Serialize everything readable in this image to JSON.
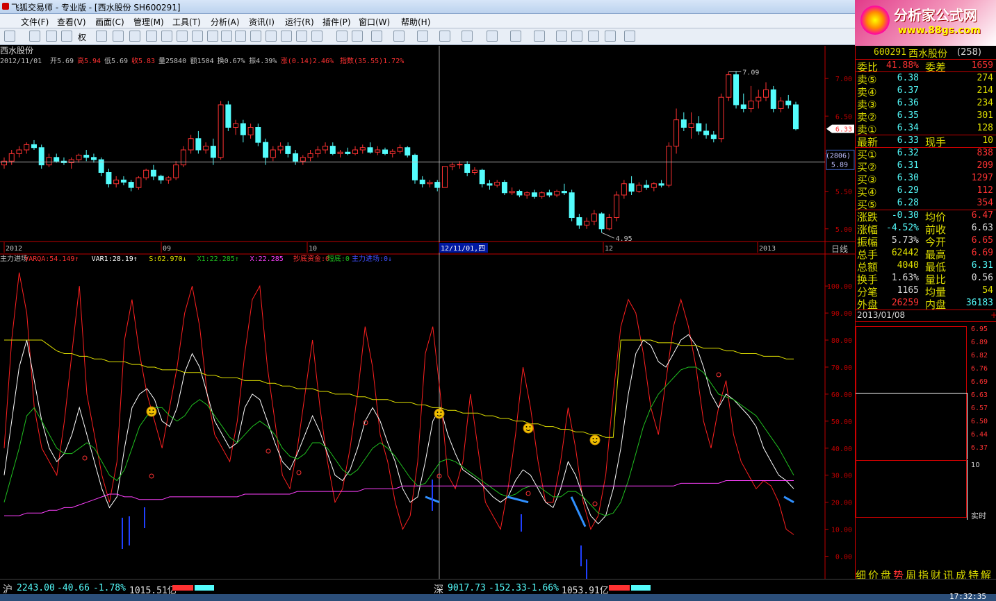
{
  "window": {
    "title": "飞狐交易师 - 专业版 - [西水股份 SH600291]"
  },
  "logo": {
    "line1": "分析家公式网",
    "line2": "www.88gs.com"
  },
  "menu": [
    "文件(F)",
    "查看(V)",
    "画面(C)",
    "管理(M)",
    "工具(T)",
    "分析(A)",
    "资讯(I)",
    "运行(R)",
    "插件(P)",
    "窗口(W)",
    "帮助(H)"
  ],
  "toolbar": {
    "quan": "权"
  },
  "info": {
    "stock": "西水股份",
    "date": "2012/11/01",
    "open": "开5.69",
    "high": "高5.94",
    "low": "低5.69",
    "close": "收5.83",
    "volume": "量25840",
    "amount": "额1504",
    "turnover": "换0.67%",
    "amplitude": "振4.39%",
    "change": "涨(0.14)2.46%",
    "index": "指数(35.55)1.72%"
  },
  "price_axis": [
    "7.00",
    "6.50",
    "6.00",
    "5.50",
    "5.00"
  ],
  "price_labels": {
    "current": "6.33",
    "cross_count": "(2806)",
    "cross_price": "5.89",
    "max": "7.09",
    "min": "4.95"
  },
  "date_axis": [
    "2012",
    "09",
    "10",
    "12/11/01,四",
    "12",
    "2013"
  ],
  "period": "日线",
  "indicator": {
    "name": "主力进场",
    "varqa": "VARQA:54.149",
    "var1": "VAR1:28.19",
    "s": "S:62.970",
    "x1": "X1:22.285",
    "x": "X:22.285",
    "chaodi": "抄底资金:0",
    "duandi": "短底:0",
    "zhuli": "主力进场:0"
  },
  "ind_axis": [
    "100.00",
    "90.00",
    "80.00",
    "70.00",
    "60.00",
    "50.00",
    "40.00",
    "30.00",
    "20.00",
    "10.00",
    "0.00"
  ],
  "quote": {
    "code": "600291",
    "name": "西水股份",
    "num": "(258)",
    "weibi_label": "委比",
    "weibi": "41.88%",
    "weicha_label": "委差",
    "weicha": "1659",
    "sell": [
      [
        "卖⑤",
        "6.38",
        "274"
      ],
      [
        "卖④",
        "6.37",
        "214"
      ],
      [
        "卖③",
        "6.36",
        "234"
      ],
      [
        "卖②",
        "6.35",
        "301"
      ],
      [
        "卖①",
        "6.34",
        "128"
      ]
    ],
    "last": [
      "最新",
      "6.33",
      "现手",
      "10"
    ],
    "buy": [
      [
        "买①",
        "6.32",
        "838"
      ],
      [
        "买②",
        "6.31",
        "209"
      ],
      [
        "买③",
        "6.30",
        "1297"
      ],
      [
        "买④",
        "6.29",
        "112"
      ],
      [
        "买⑤",
        "6.28",
        "354"
      ]
    ],
    "stats": [
      [
        "涨跌",
        "-0.30",
        "均价",
        "6.47"
      ],
      [
        "涨幅",
        "-4.52%",
        "前收",
        "6.63"
      ],
      [
        "振幅",
        "5.73%",
        "今开",
        "6.65"
      ],
      [
        "总手",
        "62442",
        "最高",
        "6.69"
      ],
      [
        "总额",
        "4040",
        "最低",
        "6.31"
      ],
      [
        "换手",
        "1.63%",
        "量比",
        "0.56"
      ],
      [
        "分笔",
        "1165",
        "均量",
        "54"
      ],
      [
        "外盘",
        "26259",
        "内盘",
        "36183"
      ]
    ],
    "mini_date": "2013/01/08",
    "mini_axis": [
      "6.95",
      "6.89",
      "6.82",
      "6.76",
      "6.69",
      "6.63",
      "6.57",
      "6.50",
      "6.44",
      "6.37"
    ],
    "mini_vol": "10",
    "mini_mode": "实时",
    "tabs": [
      "细",
      "价",
      "盘",
      "势",
      "周",
      "指",
      "财",
      "讯",
      "成",
      "特",
      "解"
    ]
  },
  "status": {
    "sh_label": "沪",
    "sh_index": "2243.00",
    "sh_change": "-40.66",
    "sh_pct": "-1.78%",
    "sh_amount": "1015.51亿",
    "sz_label": "深",
    "sz_index": "9017.73",
    "sz_change": "-152.33",
    "sz_pct": "-1.66%",
    "sz_amount": "1053.91亿",
    "time": "17:32:35"
  },
  "colors": {
    "up": "#ff3232",
    "down": "#54fcfc",
    "axis": "#c00000",
    "label": "#d8d800"
  },
  "chart_data": {
    "type": "candlestick",
    "title": "西水股份 日线",
    "candles": [
      [
        5.85,
        5.95,
        5.8,
        5.9
      ],
      [
        5.9,
        6.05,
        5.85,
        6.0
      ],
      [
        6.0,
        6.1,
        5.95,
        6.05
      ],
      [
        6.05,
        6.15,
        6.0,
        6.12
      ],
      [
        6.12,
        6.18,
        6.05,
        6.08
      ],
      [
        6.08,
        6.12,
        5.8,
        5.85
      ],
      [
        5.85,
        6.0,
        5.82,
        5.95
      ],
      [
        5.95,
        6.0,
        5.88,
        5.9
      ],
      [
        5.9,
        5.95,
        5.85,
        5.88
      ],
      [
        5.88,
        5.95,
        5.8,
        5.92
      ],
      [
        5.92,
        6.0,
        5.88,
        5.98
      ],
      [
        5.98,
        6.05,
        5.9,
        5.95
      ],
      [
        5.95,
        6.0,
        5.88,
        5.92
      ],
      [
        5.92,
        5.95,
        5.7,
        5.75
      ],
      [
        5.75,
        5.8,
        5.55,
        5.6
      ],
      [
        5.6,
        5.7,
        5.55,
        5.65
      ],
      [
        5.65,
        5.7,
        5.58,
        5.62
      ],
      [
        5.62,
        5.65,
        5.5,
        5.55
      ],
      [
        5.55,
        5.7,
        5.52,
        5.68
      ],
      [
        5.68,
        5.8,
        5.65,
        5.78
      ],
      [
        5.78,
        5.85,
        5.65,
        5.7
      ],
      [
        5.7,
        5.72,
        5.6,
        5.65
      ],
      [
        5.65,
        5.7,
        5.6,
        5.68
      ],
      [
        5.68,
        5.9,
        5.65,
        5.85
      ],
      [
        5.85,
        6.1,
        5.82,
        6.05
      ],
      [
        6.05,
        6.25,
        6.0,
        6.2
      ],
      [
        6.2,
        6.3,
        6.0,
        6.05
      ],
      [
        6.05,
        6.15,
        6.0,
        6.1
      ],
      [
        6.1,
        6.2,
        5.85,
        5.95
      ],
      [
        5.95,
        6.7,
        5.92,
        6.65
      ],
      [
        6.65,
        6.7,
        6.3,
        6.35
      ],
      [
        6.35,
        6.45,
        6.25,
        6.4
      ],
      [
        6.4,
        6.45,
        6.15,
        6.25
      ],
      [
        6.25,
        6.4,
        6.2,
        6.35
      ],
      [
        6.35,
        6.4,
        6.1,
        6.15
      ],
      [
        6.15,
        6.2,
        5.85,
        5.95
      ],
      [
        5.95,
        6.1,
        5.9,
        6.05
      ],
      [
        6.05,
        6.15,
        6.0,
        6.1
      ],
      [
        6.1,
        6.15,
        5.95,
        6.0
      ],
      [
        6.0,
        6.05,
        5.85,
        5.9
      ],
      [
        5.9,
        5.98,
        5.85,
        5.95
      ],
      [
        5.95,
        6.05,
        5.9,
        6.0
      ],
      [
        6.0,
        6.1,
        5.95,
        6.05
      ],
      [
        6.05,
        6.15,
        6.0,
        6.1
      ],
      [
        6.1,
        6.15,
        5.98,
        6.0
      ],
      [
        6.0,
        6.05,
        5.95,
        6.02
      ],
      [
        6.02,
        6.08,
        5.98,
        6.0
      ],
      [
        6.0,
        6.1,
        5.98,
        6.05
      ],
      [
        6.05,
        6.12,
        6.0,
        6.08
      ],
      [
        6.08,
        6.15,
        6.0,
        6.02
      ],
      [
        6.02,
        6.1,
        5.98,
        6.05
      ],
      [
        6.05,
        6.08,
        5.98,
        6.0
      ],
      [
        6.0,
        6.06,
        5.95,
        6.03
      ],
      [
        6.03,
        6.12,
        6.0,
        6.08
      ],
      [
        6.08,
        6.1,
        5.95,
        5.98
      ],
      [
        5.98,
        6.0,
        5.6,
        5.65
      ],
      [
        5.65,
        5.7,
        5.55,
        5.6
      ],
      [
        5.6,
        5.65,
        5.55,
        5.62
      ],
      [
        5.62,
        5.65,
        5.5,
        5.55
      ],
      [
        5.55,
        5.83,
        5.69,
        5.83
      ],
      [
        5.83,
        5.88,
        5.78,
        5.85
      ],
      [
        5.85,
        5.9,
        5.8,
        5.86
      ],
      [
        5.86,
        5.9,
        5.7,
        5.75
      ],
      [
        5.75,
        5.82,
        5.72,
        5.78
      ],
      [
        5.78,
        5.8,
        5.55,
        5.6
      ],
      [
        5.6,
        5.65,
        5.52,
        5.58
      ],
      [
        5.58,
        5.65,
        5.55,
        5.62
      ],
      [
        5.62,
        5.65,
        5.45,
        5.48
      ],
      [
        5.48,
        5.55,
        5.45,
        5.5
      ],
      [
        5.5,
        5.52,
        5.42,
        5.45
      ],
      [
        5.45,
        5.5,
        5.4,
        5.48
      ],
      [
        5.48,
        5.52,
        5.4,
        5.43
      ],
      [
        5.43,
        5.5,
        5.4,
        5.48
      ],
      [
        5.48,
        5.52,
        5.42,
        5.45
      ],
      [
        5.45,
        5.52,
        5.42,
        5.5
      ],
      [
        5.5,
        5.6,
        5.45,
        5.48
      ],
      [
        5.48,
        5.52,
        5.1,
        5.15
      ],
      [
        5.15,
        5.2,
        5.0,
        5.05
      ],
      [
        5.05,
        5.15,
        5.0,
        5.1
      ],
      [
        5.1,
        5.25,
        5.05,
        5.2
      ],
      [
        5.2,
        5.22,
        4.95,
        5.0
      ],
      [
        5.0,
        5.2,
        4.98,
        5.15
      ],
      [
        5.15,
        5.5,
        5.1,
        5.45
      ],
      [
        5.45,
        5.65,
        5.4,
        5.6
      ],
      [
        5.6,
        5.7,
        5.45,
        5.5
      ],
      [
        5.5,
        5.62,
        5.48,
        5.58
      ],
      [
        5.58,
        5.65,
        5.52,
        5.55
      ],
      [
        5.55,
        5.62,
        5.5,
        5.6
      ],
      [
        5.6,
        5.65,
        5.55,
        5.58
      ],
      [
        5.58,
        6.15,
        5.55,
        6.1
      ],
      [
        6.1,
        6.6,
        6.0,
        6.45
      ],
      [
        6.45,
        6.55,
        6.3,
        6.35
      ],
      [
        6.35,
        6.55,
        6.2,
        6.4
      ],
      [
        6.4,
        6.5,
        6.25,
        6.3
      ],
      [
        6.3,
        6.4,
        6.2,
        6.25
      ],
      [
        6.25,
        6.3,
        6.15,
        6.2
      ],
      [
        6.2,
        6.8,
        6.15,
        6.75
      ],
      [
        6.75,
        7.09,
        6.7,
        7.05
      ],
      [
        7.05,
        7.1,
        6.6,
        6.65
      ],
      [
        6.65,
        6.8,
        6.55,
        6.6
      ],
      [
        6.6,
        6.9,
        6.55,
        6.7
      ],
      [
        6.7,
        6.85,
        6.6,
        6.75
      ],
      [
        6.75,
        6.95,
        6.7,
        6.85
      ],
      [
        6.85,
        6.9,
        6.55,
        6.6
      ],
      [
        6.6,
        6.75,
        6.55,
        6.7
      ],
      [
        6.7,
        6.78,
        6.6,
        6.65
      ],
      [
        6.65,
        6.69,
        6.31,
        6.33
      ]
    ],
    "ylim": [
      4.85,
      7.25
    ],
    "indicator_ylim": [
      -5,
      108
    ],
    "series": [
      {
        "name": "VARQA",
        "color": "#ff2020",
        "values": [
          40,
          80,
          105,
          90,
          55,
          40,
          35,
          30,
          50,
          75,
          100,
          60,
          45,
          30,
          20,
          35,
          80,
          95,
          75,
          60,
          50,
          40,
          55,
          70,
          90,
          100,
          85,
          60,
          45,
          40,
          35,
          50,
          75,
          95,
          100,
          70,
          50,
          30,
          25,
          40,
          60,
          80,
          55,
          35,
          20,
          25,
          40,
          60,
          85,
          70,
          45,
          35,
          20,
          10,
          15,
          35,
          75,
          85,
          60,
          30,
          25,
          35,
          60,
          40,
          20,
          15,
          10,
          25,
          45,
          70,
          55,
          35,
          20,
          20,
          35,
          55,
          40,
          20,
          10,
          15,
          30,
          60,
          85,
          95,
          90,
          75,
          55,
          45,
          65,
          85,
          95,
          85,
          70,
          50,
          40,
          55,
          65,
          45,
          35,
          30,
          25,
          28,
          26,
          20,
          10,
          8
        ]
      },
      {
        "name": "VAR1",
        "color": "#ffffff",
        "values": [
          30,
          50,
          70,
          80,
          65,
          50,
          40,
          35,
          38,
          45,
          55,
          45,
          35,
          25,
          18,
          22,
          40,
          55,
          60,
          62,
          58,
          50,
          48,
          55,
          68,
          75,
          70,
          60,
          50,
          45,
          40,
          42,
          55,
          60,
          58,
          50,
          42,
          35,
          32,
          38,
          45,
          52,
          46,
          38,
          30,
          28,
          32,
          40,
          50,
          55,
          50,
          42,
          35,
          25,
          20,
          22,
          35,
          50,
          55,
          45,
          38,
          32,
          30,
          28,
          25,
          22,
          20,
          22,
          28,
          32,
          30,
          25,
          20,
          18,
          25,
          35,
          30,
          22,
          15,
          12,
          15,
          25,
          40,
          60,
          75,
          80,
          78,
          72,
          70,
          75,
          80,
          82,
          78,
          70,
          60,
          55,
          60,
          58,
          55,
          52,
          48,
          40,
          35,
          30,
          28,
          25
        ]
      },
      {
        "name": "S",
        "color": "#e0e000",
        "values": [
          80,
          80,
          80,
          80,
          80,
          80,
          78,
          76,
          75,
          75,
          74,
          74,
          73,
          73,
          72,
          72,
          72,
          71,
          71,
          70,
          70,
          69,
          69,
          69,
          68,
          68,
          68,
          67,
          67,
          66,
          66,
          66,
          65,
          65,
          65,
          64,
          64,
          63,
          63,
          62,
          62,
          62,
          61,
          61,
          60,
          60,
          60,
          59,
          59,
          58,
          58,
          58,
          57,
          57,
          57,
          56,
          56,
          55,
          55,
          54,
          54,
          53,
          53,
          53,
          52,
          52,
          51,
          51,
          50,
          50,
          49,
          49,
          48,
          48,
          47,
          47,
          46,
          46,
          45,
          45,
          44,
          44,
          80,
          80,
          80,
          80,
          80,
          79,
          79,
          79,
          78,
          78,
          78,
          77,
          77,
          77,
          76,
          76,
          75,
          75,
          75,
          74,
          74,
          74,
          73,
          73
        ]
      },
      {
        "name": "X1",
        "color": "#20c020",
        "values": [
          20,
          30,
          40,
          52,
          55,
          50,
          45,
          40,
          38,
          38,
          40,
          42,
          40,
          35,
          30,
          28,
          32,
          40,
          48,
          52,
          55,
          55,
          52,
          50,
          52,
          56,
          58,
          56,
          52,
          48,
          44,
          42,
          45,
          48,
          50,
          48,
          45,
          40,
          37,
          36,
          38,
          42,
          42,
          40,
          36,
          32,
          30,
          32,
          36,
          40,
          42,
          40,
          37,
          33,
          29,
          26,
          27,
          31,
          35,
          36,
          35,
          33,
          31,
          29,
          27,
          25,
          23,
          22,
          23,
          25,
          26,
          26,
          24,
          22,
          22,
          24,
          24,
          22,
          19,
          16,
          15,
          16,
          20,
          28,
          38,
          48,
          55,
          60,
          63,
          66,
          69,
          70,
          70,
          68,
          64,
          60,
          59,
          58,
          56,
          54,
          52,
          48,
          44,
          40,
          35,
          30
        ]
      },
      {
        "name": "X",
        "color": "#ff40ff",
        "values": [
          15,
          15,
          15,
          16,
          16,
          16,
          17,
          17,
          18,
          18,
          19,
          20,
          21,
          22,
          23,
          23,
          22,
          22,
          21,
          21,
          21,
          21,
          22,
          22,
          22,
          22,
          22,
          22,
          22,
          22,
          22,
          22,
          23,
          23,
          23,
          23,
          23,
          23,
          23,
          24,
          24,
          24,
          24,
          24,
          24,
          24,
          24,
          24,
          25,
          25,
          25,
          25,
          25,
          26,
          26,
          26,
          26,
          26,
          26,
          26,
          26,
          26,
          26,
          26,
          26,
          26,
          26,
          26,
          26,
          26,
          26,
          26,
          26,
          26,
          26,
          26,
          26,
          26,
          26,
          26,
          26,
          26,
          26,
          26,
          26,
          26,
          26,
          26,
          26,
          26,
          27,
          27,
          27,
          27,
          27,
          27,
          28,
          28,
          28,
          28,
          28,
          28,
          28,
          28,
          28,
          28
        ]
      }
    ]
  }
}
